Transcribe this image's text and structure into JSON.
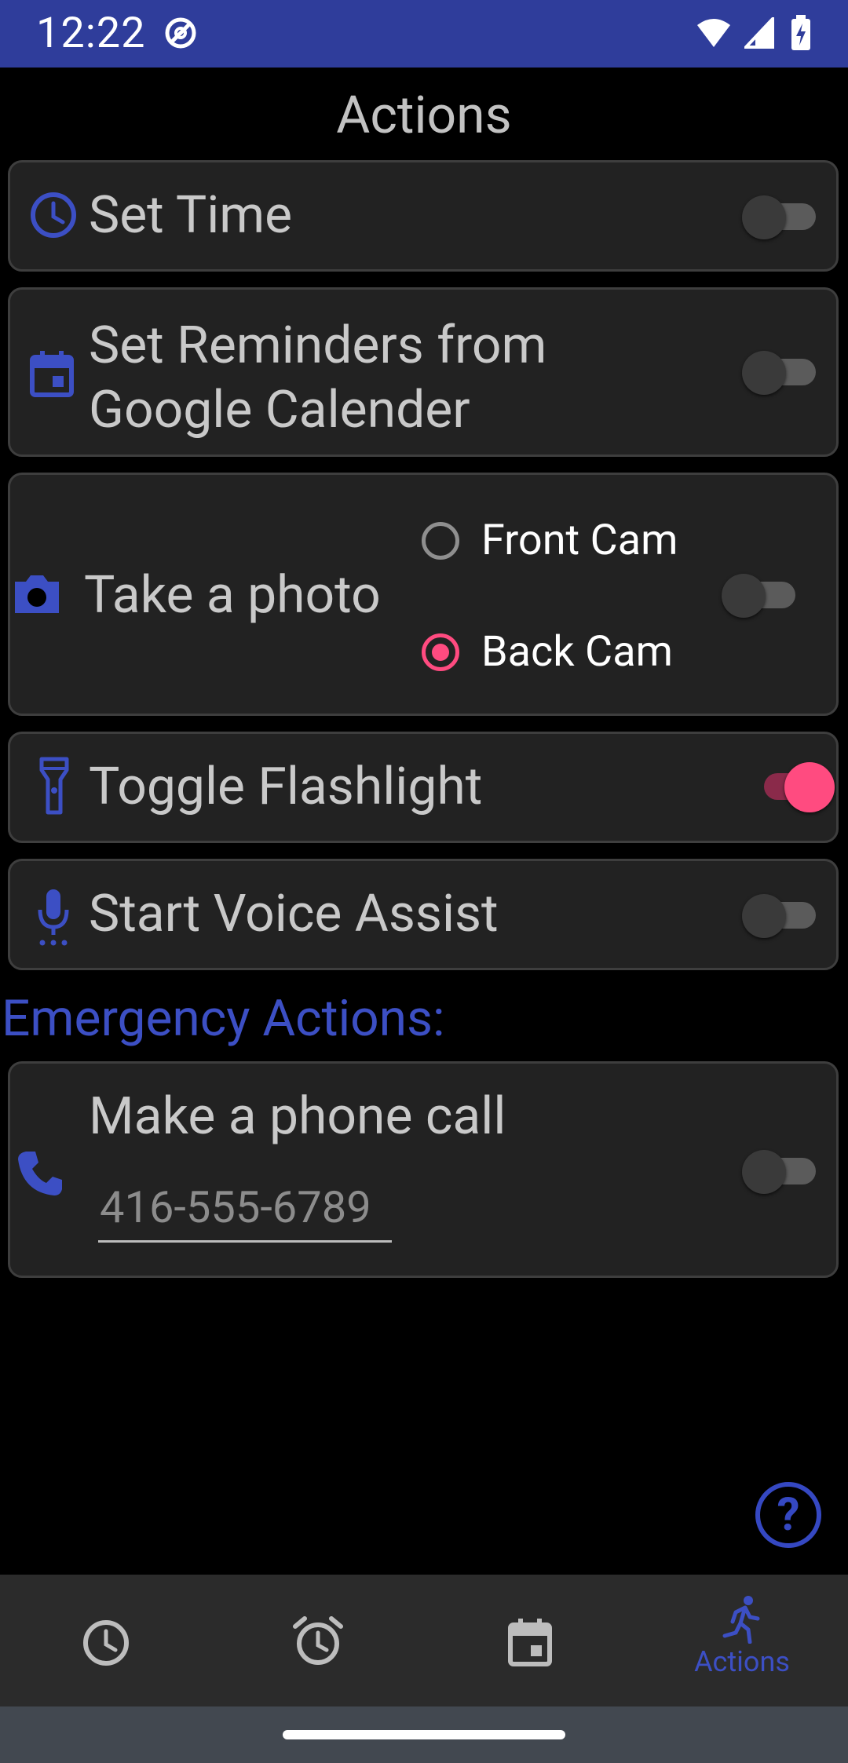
{
  "status_bar": {
    "time": "12:22"
  },
  "title": "Actions",
  "actions": [
    {
      "label": "Set Time",
      "icon": "clock-icon",
      "enabled": false
    },
    {
      "label_line1": "Set Reminders from",
      "label_line2": "Google Calender",
      "icon": "calendar-icon",
      "enabled": false
    },
    {
      "label": "Take a photo",
      "icon": "camera-icon",
      "enabled": false,
      "options": [
        {
          "label": "Front Cam",
          "selected": false
        },
        {
          "label": "Back Cam",
          "selected": true
        }
      ]
    },
    {
      "label": "Toggle Flashlight",
      "icon": "flashlight-icon",
      "enabled": true
    },
    {
      "label": "Start Voice Assist",
      "icon": "microphone-icon",
      "enabled": false
    }
  ],
  "emergency": {
    "title": "Emergency Actions:",
    "phone_call": {
      "label": "Make a phone call",
      "icon": "phone-icon",
      "placeholder": "416-555-6789",
      "value": "",
      "enabled": false
    }
  },
  "help": {
    "label": "?"
  },
  "bottom_nav": [
    {
      "icon": "clock-icon",
      "label": ""
    },
    {
      "icon": "alarm-icon",
      "label": ""
    },
    {
      "icon": "calendar-icon",
      "label": ""
    },
    {
      "icon": "running-person-icon",
      "label": "Actions",
      "active": true
    }
  ],
  "colors": {
    "status_bar": "#2f3d9b",
    "accent": "#3c4fc4",
    "switch_on": "#ff4b80",
    "card": "#222222"
  }
}
